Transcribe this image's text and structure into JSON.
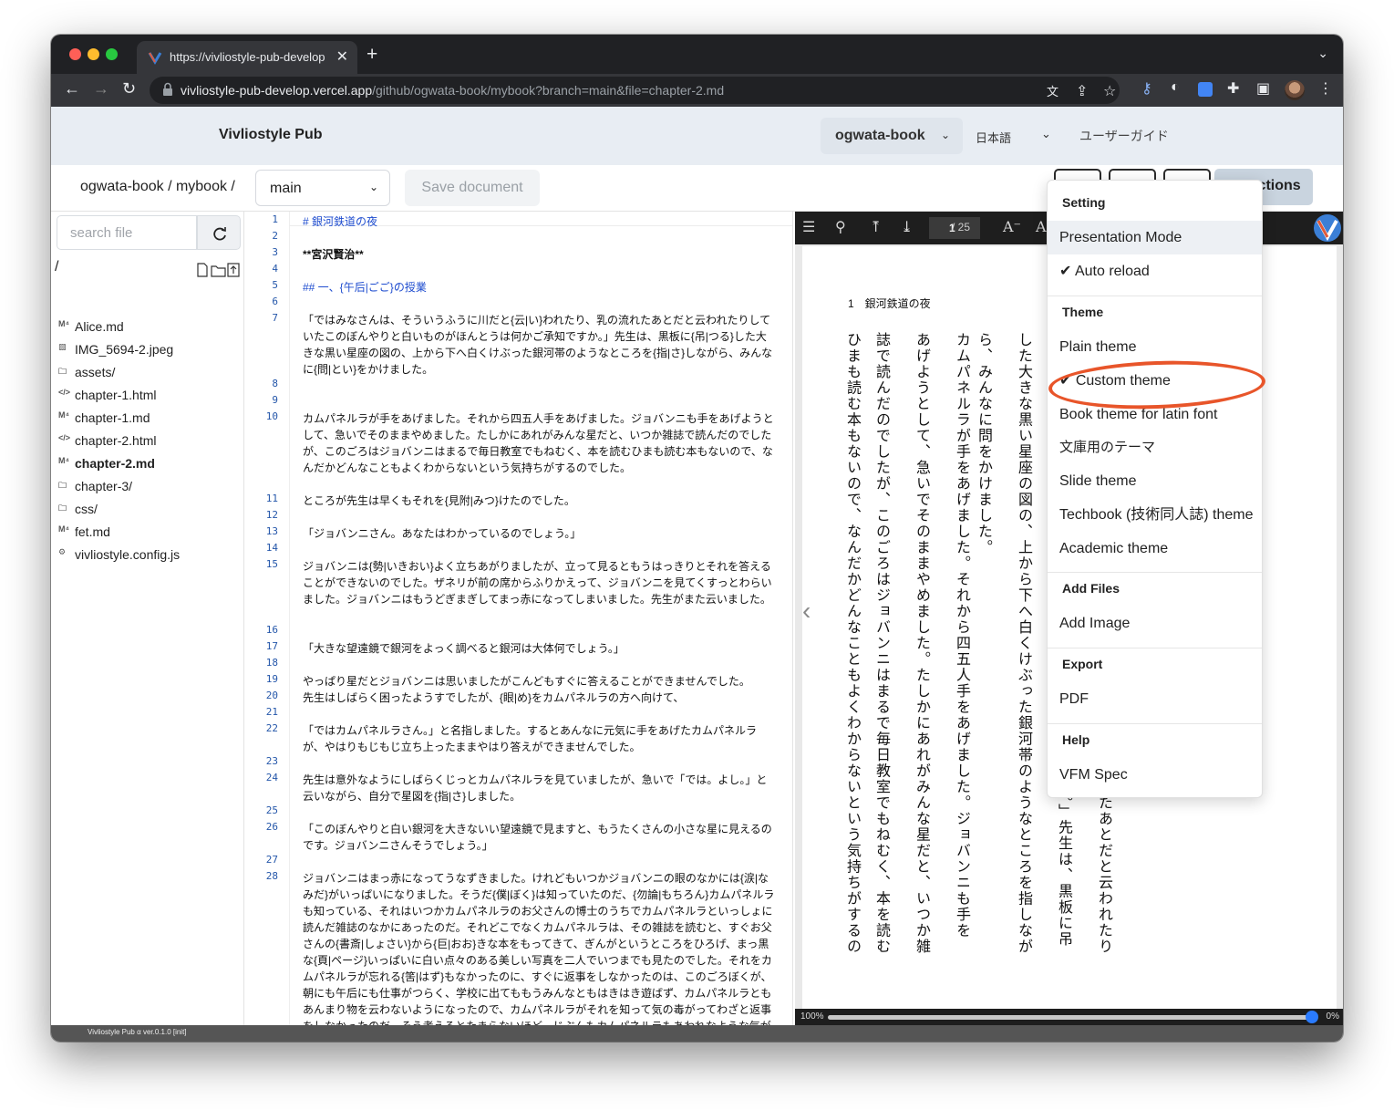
{
  "browser": {
    "tab_title": "https://vivliostyle-pub-develop",
    "url_host": "vivliostyle-pub-develop.vercel.app",
    "url_path": "/github/ogwata-book/mybook?branch=main&file=chapter-2.md"
  },
  "header": {
    "brand": "Vivliostyle Pub",
    "user": "ogwata-book",
    "language": "日本語",
    "user_guide": "ユーザーガイド"
  },
  "toolbar": {
    "breadcrumb": "ogwata-book / mybook /",
    "branch": "main",
    "save_label": "Save document",
    "actions_label": "Actions",
    "actions_icon": "?"
  },
  "sidebar": {
    "search_placeholder": "search file",
    "root": "/",
    "files": [
      {
        "icon": "M⁴",
        "name": "Alice.md"
      },
      {
        "icon": "▧",
        "name": "IMG_5694-2.jpeg"
      },
      {
        "icon": "🗀",
        "name": "assets/"
      },
      {
        "icon": "</>",
        "name": "chapter-1.html"
      },
      {
        "icon": "M⁴",
        "name": "chapter-1.md"
      },
      {
        "icon": "</>",
        "name": "chapter-2.html"
      },
      {
        "icon": "M⁴",
        "name": "chapter-2.md"
      },
      {
        "icon": "🗀",
        "name": "chapter-3/"
      },
      {
        "icon": "🗀",
        "name": "css/"
      },
      {
        "icon": "M⁴",
        "name": "fet.md"
      },
      {
        "icon": "⚙",
        "name": "vivliostyle.config.js"
      }
    ]
  },
  "editor": {
    "lines": [
      {
        "n": "1",
        "t": "# 銀河鉄道の夜",
        "c": "head"
      },
      {
        "n": "2",
        "t": ""
      },
      {
        "n": "3",
        "t": "**宮沢賢治**",
        "c": "bold"
      },
      {
        "n": "4",
        "t": ""
      },
      {
        "n": "5",
        "t": "## 一、{午后|ごご}の授業",
        "c": "head"
      },
      {
        "n": "6",
        "t": ""
      },
      {
        "n": "7",
        "t": "「ではみなさんは、そういうふうに川だと{云|い}われたり、乳の流れたあとだと云われたりしていたこのぼんやりと白いものがほんとうは何かご承知ですか。」先生は、黒板に{吊|つる}した大きな黒い星座の図の、上から下へ白くけぶった銀河帯のようなところを{指|さ}しながら、みんなに{問|とい}をかけました。"
      },
      {
        "n": "8",
        "t": ""
      },
      {
        "n": "9",
        "t": ""
      },
      {
        "n": "10",
        "t": "カムパネルラが手をあげました。それから四五人手をあげました。ジョバンニも手をあげようとして、急いでそのままやめました。たしかにあれがみんな星だと、いつか雑誌で読んだのでしたが、このごろはジョバンニはまるで毎日教室でもねむく、本を読むひまも読む本もないので、なんだかどんなこともよくわからないという気持ちがするのでした。"
      },
      {
        "n": "11",
        "t": "ところが先生は早くもそれを{見附|みつ}けたのでした。"
      },
      {
        "n": "12",
        "t": ""
      },
      {
        "n": "13",
        "t": "「ジョバンニさん。あなたはわかっているのでしょう。」"
      },
      {
        "n": "14",
        "t": ""
      },
      {
        "n": "15",
        "t": "ジョバンニは{勢|いきおい}よく立ちあがりましたが、立って見るともうはっきりとそれを答えることができないのでした。ザネリが前の席からふりかえって、ジョバンニを見てくすっとわらいました。ジョバンニはもうどぎまぎしてまっ赤になってしまいました。先生がまた云いました。"
      },
      {
        "n": "16",
        "t": ""
      },
      {
        "n": "17",
        "t": "「大きな望遠鏡で銀河をよっく調べると銀河は大体何でしょう。」"
      },
      {
        "n": "18",
        "t": ""
      },
      {
        "n": "19",
        "t": "やっぱり星だとジョバンニは思いましたがこんどもすぐに答えることができませんでした。"
      },
      {
        "n": "20",
        "t": "先生はしばらく困ったようすでしたが、{眼|め}をカムパネルラの方へ向けて、"
      },
      {
        "n": "21",
        "t": ""
      },
      {
        "n": "22",
        "t": "「ではカムパネルラさん。」と名指しました。するとあんなに元気に手をあげたカムパネルラが、やはりもじもじ立ち上ったままやはり答えができませんでした。"
      },
      {
        "n": "23",
        "t": ""
      },
      {
        "n": "24",
        "t": "先生は意外なようにしばらくじっとカムパネルラを見ていましたが、急いで「では。よし。」と云いながら、自分で星図を{指|さ}しました。"
      },
      {
        "n": "25",
        "t": ""
      },
      {
        "n": "26",
        "t": "「このぼんやりと白い銀河を大きないい望遠鏡で見ますと、もうたくさんの小さな星に見えるのです。ジョバンニさんそうでしょう。」"
      },
      {
        "n": "27",
        "t": ""
      },
      {
        "n": "28",
        "t": "ジョバンニはまっ赤になってうなずきました。けれどもいつかジョバンニの眼のなかには{涙|なみだ}がいっぱいになりました。そうだ{僕|ぼく}は知っていたのだ、{勿論|もちろん}カムパネルラも知っている、それはいつかカムパネルラのお父さんの博士のうちでカムパネルラといっしょに読んだ雑誌のなかにあったのだ。それどこでなくカムパネルラは、その雑誌を読むと、すぐお父さんの{書斎|しょさい}から{巨|おお}きな本をもってきて、ぎんがというところをひろげ、まっ黒な{頁|ページ}いっぱいに白い点々のある美しい写真を二人でいつまでも見たのでした。それをカムパネルラが忘れる{筈|はず}もなかったのに、すぐに返事をしなかったのは、このごろぼくが、朝にも午后にも仕事がつらく、学校に出てももうみんなともはきはき遊ばず、カムパネルラともあんまり物を云わないようになったので、カムパネルラがそれを知って気の毒がってわざと返事をしなかったのだ、そう考えるとたまらないほど、じぶんもカムパネルラもあわれなような気がするのでした。"
      }
    ]
  },
  "viewer": {
    "page_current": "1",
    "page_total": "/ 25",
    "heading": "1　銀河鉄道の夜",
    "columns": [
      "「ではみなさんは、そういうふうに川だと云われたり、乳の流れたあとだと云われたり",
      "していたこのぼんやりと白いものがほんとうは何かご承知ですか。」先生は、黒板に吊",
      "した大きな黒い星座の図の、上から下へ白くけぶった銀河帯のようなところを指しなが",
      "ら、みんなに問をかけました。",
      "カムパネルラが手をあげました。それから四五人手をあげました。ジョバンニも手を",
      "あげようとして、急いでそのままやめました。たしかにあれがみんな星だと、いつか雑",
      "誌で読んだのでしたが、このごろはジョバンニはまるで毎日教室でもねむく、本を読む",
      "ひまも読む本もないので、なんだかどんなこともよくわからないという気持ちがするの"
    ],
    "zoom_left": "100%",
    "zoom_right": "0%"
  },
  "menu": {
    "setting_header": "Setting",
    "presentation_mode": "Presentation Mode",
    "auto_reload": "✔ Auto reload",
    "theme_header": "Theme",
    "themes": [
      "Plain theme",
      "✔ Custom theme",
      "Book theme for latin font",
      "文庫用のテーマ",
      "Slide theme",
      "Techbook (技術同人誌) theme",
      "Academic theme"
    ],
    "add_files_header": "Add Files",
    "add_image": "Add Image",
    "export_header": "Export",
    "pdf": "PDF",
    "help_header": "Help",
    "vfm_spec": "VFM Spec"
  },
  "status": {
    "version": "Vivliostyle Pub α ver.0.1.0 [init]"
  },
  "colors": {
    "accent": "#2557aa",
    "highlight_circle": "#e8552a",
    "header_bg": "#e8edf3"
  }
}
